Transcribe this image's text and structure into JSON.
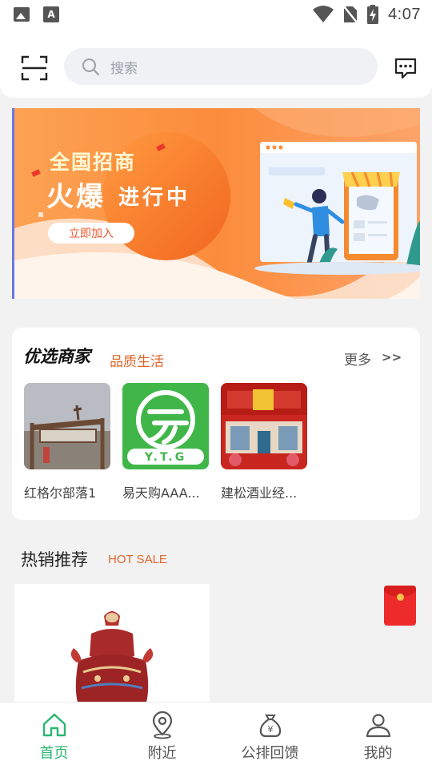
{
  "status_bar": {
    "time": "4:07",
    "icons": [
      "image-icon",
      "text-a-icon",
      "wifi-icon",
      "no-sim-icon",
      "battery-charging-icon"
    ]
  },
  "header": {
    "scan_icon": "scan-icon",
    "search_placeholder": "搜索",
    "message_icon": "message-icon"
  },
  "banner": {
    "headline_1": "全国招商",
    "headline_2_big": "火爆",
    "headline_2_rest": "进行中",
    "cta": "立即加入"
  },
  "featured": {
    "title": "优选商家",
    "subtitle": "品质生活",
    "more_label": "更多",
    "more_arrow": ">>",
    "merchants": [
      {
        "name": "红格尔部落1"
      },
      {
        "name": "易天购AAA..."
      },
      {
        "name": "建松酒业经..."
      }
    ]
  },
  "hot_sale": {
    "title": "热销推荐",
    "subtitle": "HOT SALE"
  },
  "bottom_nav": {
    "items": [
      {
        "label": "首页",
        "icon": "home-icon",
        "active": true
      },
      {
        "label": "附近",
        "icon": "location-pin-icon",
        "active": false
      },
      {
        "label": "公排回馈",
        "icon": "money-bag-icon",
        "active": false
      },
      {
        "label": "我的",
        "icon": "user-icon",
        "active": false
      }
    ]
  },
  "colors": {
    "accent_green": "#2bb673",
    "accent_orange": "#e0662a",
    "banner_orange": "#fb8c3c"
  }
}
